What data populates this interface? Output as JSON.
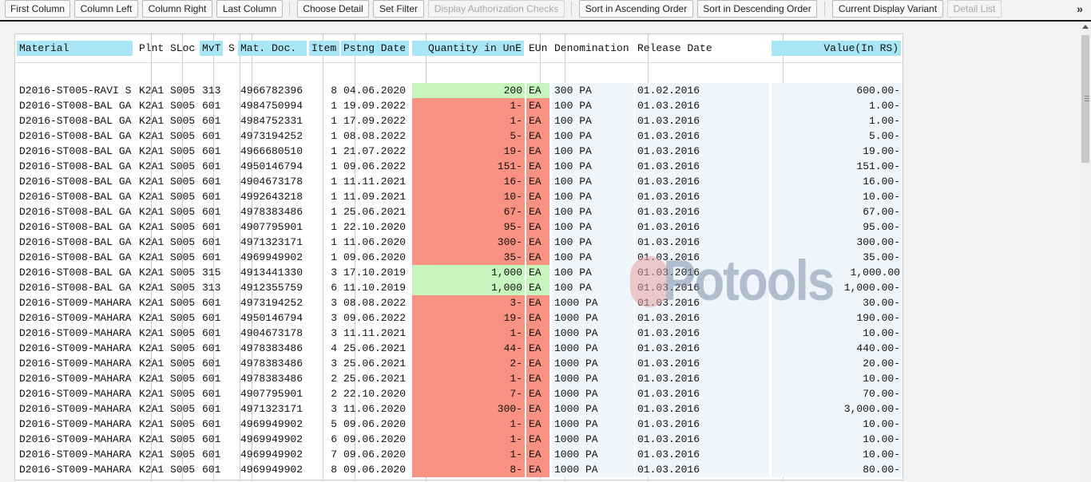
{
  "toolbar": {
    "buttons": [
      {
        "label": "First Column",
        "disabled": false
      },
      {
        "label": "Column Left",
        "disabled": false
      },
      {
        "label": "Column Right",
        "disabled": false
      },
      {
        "label": "Last Column",
        "disabled": false
      },
      {
        "label": "Choose Detail",
        "disabled": false
      },
      {
        "label": "Set Filter",
        "disabled": false
      },
      {
        "label": "Display Authorization Checks",
        "disabled": true
      },
      {
        "label": "Sort in Ascending Order",
        "disabled": false
      },
      {
        "label": "Sort in Descending Order",
        "disabled": false
      },
      {
        "label": "Current Display Variant",
        "disabled": false
      },
      {
        "label": "Detail List",
        "disabled": true
      }
    ],
    "more_label": "»"
  },
  "columns": [
    "Material",
    "Plnt",
    "SLoc",
    "MvT",
    "S",
    "Mat. Doc.",
    "Item",
    "Pstng Date",
    "Quantity in UnE",
    "EUn",
    "Denomination",
    "Release Date",
    "Value(In RS)"
  ],
  "watermark_text": "Potools",
  "colors": {
    "header_bg": "#a9e6f5",
    "negative_qty": "#fa9283",
    "positive_qty": "#c6f5bd",
    "light_cell": "#eef6fc"
  },
  "rows": [
    {
      "material": "D2016-ST005-RAVI S",
      "plnt": "K2A1",
      "sloc": "S005",
      "mvt": "313",
      "s": "",
      "matdoc": "4966782396",
      "item": "8",
      "date": "04.06.2020",
      "qty": "200",
      "eun": "EA",
      "denom": "300 PA",
      "release": "01.02.2016",
      "value": "600.00-",
      "sign": "pos"
    },
    {
      "material": "D2016-ST008-BAL GA",
      "plnt": "K2A1",
      "sloc": "S005",
      "mvt": "601",
      "s": "",
      "matdoc": "4984750994",
      "item": "1",
      "date": "19.09.2022",
      "qty": "1-",
      "eun": "EA",
      "denom": "100 PA",
      "release": "01.03.2016",
      "value": "1.00-",
      "sign": "neg"
    },
    {
      "material": "D2016-ST008-BAL GA",
      "plnt": "K2A1",
      "sloc": "S005",
      "mvt": "601",
      "s": "",
      "matdoc": "4984752331",
      "item": "1",
      "date": "17.09.2022",
      "qty": "1-",
      "eun": "EA",
      "denom": "100 PA",
      "release": "01.03.2016",
      "value": "1.00-",
      "sign": "neg"
    },
    {
      "material": "D2016-ST008-BAL GA",
      "plnt": "K2A1",
      "sloc": "S005",
      "mvt": "601",
      "s": "",
      "matdoc": "4973194252",
      "item": "1",
      "date": "08.08.2022",
      "qty": "5-",
      "eun": "EA",
      "denom": "100 PA",
      "release": "01.03.2016",
      "value": "5.00-",
      "sign": "neg"
    },
    {
      "material": "D2016-ST008-BAL GA",
      "plnt": "K2A1",
      "sloc": "S005",
      "mvt": "601",
      "s": "",
      "matdoc": "4966680510",
      "item": "1",
      "date": "21.07.2022",
      "qty": "19-",
      "eun": "EA",
      "denom": "100 PA",
      "release": "01.03.2016",
      "value": "19.00-",
      "sign": "neg"
    },
    {
      "material": "D2016-ST008-BAL GA",
      "plnt": "K2A1",
      "sloc": "S005",
      "mvt": "601",
      "s": "",
      "matdoc": "4950146794",
      "item": "1",
      "date": "09.06.2022",
      "qty": "151-",
      "eun": "EA",
      "denom": "100 PA",
      "release": "01.03.2016",
      "value": "151.00-",
      "sign": "neg"
    },
    {
      "material": "D2016-ST008-BAL GA",
      "plnt": "K2A1",
      "sloc": "S005",
      "mvt": "601",
      "s": "",
      "matdoc": "4904673178",
      "item": "1",
      "date": "11.11.2021",
      "qty": "16-",
      "eun": "EA",
      "denom": "100 PA",
      "release": "01.03.2016",
      "value": "16.00-",
      "sign": "neg"
    },
    {
      "material": "D2016-ST008-BAL GA",
      "plnt": "K2A1",
      "sloc": "S005",
      "mvt": "601",
      "s": "",
      "matdoc": "4992643218",
      "item": "1",
      "date": "11.09.2021",
      "qty": "10-",
      "eun": "EA",
      "denom": "100 PA",
      "release": "01.03.2016",
      "value": "10.00-",
      "sign": "neg"
    },
    {
      "material": "D2016-ST008-BAL GA",
      "plnt": "K2A1",
      "sloc": "S005",
      "mvt": "601",
      "s": "",
      "matdoc": "4978383486",
      "item": "1",
      "date": "25.06.2021",
      "qty": "67-",
      "eun": "EA",
      "denom": "100 PA",
      "release": "01.03.2016",
      "value": "67.00-",
      "sign": "neg"
    },
    {
      "material": "D2016-ST008-BAL GA",
      "plnt": "K2A1",
      "sloc": "S005",
      "mvt": "601",
      "s": "",
      "matdoc": "4907795901",
      "item": "1",
      "date": "22.10.2020",
      "qty": "95-",
      "eun": "EA",
      "denom": "100 PA",
      "release": "01.03.2016",
      "value": "95.00-",
      "sign": "neg"
    },
    {
      "material": "D2016-ST008-BAL GA",
      "plnt": "K2A1",
      "sloc": "S005",
      "mvt": "601",
      "s": "",
      "matdoc": "4971323171",
      "item": "1",
      "date": "11.06.2020",
      "qty": "300-",
      "eun": "EA",
      "denom": "100 PA",
      "release": "01.03.2016",
      "value": "300.00-",
      "sign": "neg"
    },
    {
      "material": "D2016-ST008-BAL GA",
      "plnt": "K2A1",
      "sloc": "S005",
      "mvt": "601",
      "s": "",
      "matdoc": "4969949902",
      "item": "1",
      "date": "09.06.2020",
      "qty": "35-",
      "eun": "EA",
      "denom": "100 PA",
      "release": "01.03.2016",
      "value": "35.00-",
      "sign": "neg"
    },
    {
      "material": "D2016-ST008-BAL GA",
      "plnt": "K2A1",
      "sloc": "S005",
      "mvt": "315",
      "s": "",
      "matdoc": "4913441330",
      "item": "3",
      "date": "17.10.2019",
      "qty": "1,000",
      "eun": "EA",
      "denom": "100 PA",
      "release": "01.03.2016",
      "value": "1,000.00",
      "sign": "pos"
    },
    {
      "material": "D2016-ST008-BAL GA",
      "plnt": "K2A1",
      "sloc": "S005",
      "mvt": "313",
      "s": "",
      "matdoc": "4912355759",
      "item": "6",
      "date": "11.10.2019",
      "qty": "1,000",
      "eun": "EA",
      "denom": "100 PA",
      "release": "01.03.2016",
      "value": "1,000.00-",
      "sign": "pos"
    },
    {
      "material": "D2016-ST009-MAHARA",
      "plnt": "K2A1",
      "sloc": "S005",
      "mvt": "601",
      "s": "",
      "matdoc": "4973194252",
      "item": "3",
      "date": "08.08.2022",
      "qty": "3-",
      "eun": "EA",
      "denom": "1000 PA",
      "release": "01.03.2016",
      "value": "30.00-",
      "sign": "neg"
    },
    {
      "material": "D2016-ST009-MAHARA",
      "plnt": "K2A1",
      "sloc": "S005",
      "mvt": "601",
      "s": "",
      "matdoc": "4950146794",
      "item": "3",
      "date": "09.06.2022",
      "qty": "19-",
      "eun": "EA",
      "denom": "1000 PA",
      "release": "01.03.2016",
      "value": "190.00-",
      "sign": "neg"
    },
    {
      "material": "D2016-ST009-MAHARA",
      "plnt": "K2A1",
      "sloc": "S005",
      "mvt": "601",
      "s": "",
      "matdoc": "4904673178",
      "item": "3",
      "date": "11.11.2021",
      "qty": "1-",
      "eun": "EA",
      "denom": "1000 PA",
      "release": "01.03.2016",
      "value": "10.00-",
      "sign": "neg"
    },
    {
      "material": "D2016-ST009-MAHARA",
      "plnt": "K2A1",
      "sloc": "S005",
      "mvt": "601",
      "s": "",
      "matdoc": "4978383486",
      "item": "4",
      "date": "25.06.2021",
      "qty": "44-",
      "eun": "EA",
      "denom": "1000 PA",
      "release": "01.03.2016",
      "value": "440.00-",
      "sign": "neg"
    },
    {
      "material": "D2016-ST009-MAHARA",
      "plnt": "K2A1",
      "sloc": "S005",
      "mvt": "601",
      "s": "",
      "matdoc": "4978383486",
      "item": "3",
      "date": "25.06.2021",
      "qty": "2-",
      "eun": "EA",
      "denom": "1000 PA",
      "release": "01.03.2016",
      "value": "20.00-",
      "sign": "neg"
    },
    {
      "material": "D2016-ST009-MAHARA",
      "plnt": "K2A1",
      "sloc": "S005",
      "mvt": "601",
      "s": "",
      "matdoc": "4978383486",
      "item": "2",
      "date": "25.06.2021",
      "qty": "1-",
      "eun": "EA",
      "denom": "1000 PA",
      "release": "01.03.2016",
      "value": "10.00-",
      "sign": "neg"
    },
    {
      "material": "D2016-ST009-MAHARA",
      "plnt": "K2A1",
      "sloc": "S005",
      "mvt": "601",
      "s": "",
      "matdoc": "4907795901",
      "item": "2",
      "date": "22.10.2020",
      "qty": "7-",
      "eun": "EA",
      "denom": "1000 PA",
      "release": "01.03.2016",
      "value": "70.00-",
      "sign": "neg"
    },
    {
      "material": "D2016-ST009-MAHARA",
      "plnt": "K2A1",
      "sloc": "S005",
      "mvt": "601",
      "s": "",
      "matdoc": "4971323171",
      "item": "3",
      "date": "11.06.2020",
      "qty": "300-",
      "eun": "EA",
      "denom": "1000 PA",
      "release": "01.03.2016",
      "value": "3,000.00-",
      "sign": "neg"
    },
    {
      "material": "D2016-ST009-MAHARA",
      "plnt": "K2A1",
      "sloc": "S005",
      "mvt": "601",
      "s": "",
      "matdoc": "4969949902",
      "item": "5",
      "date": "09.06.2020",
      "qty": "1-",
      "eun": "EA",
      "denom": "1000 PA",
      "release": "01.03.2016",
      "value": "10.00-",
      "sign": "neg"
    },
    {
      "material": "D2016-ST009-MAHARA",
      "plnt": "K2A1",
      "sloc": "S005",
      "mvt": "601",
      "s": "",
      "matdoc": "4969949902",
      "item": "6",
      "date": "09.06.2020",
      "qty": "1-",
      "eun": "EA",
      "denom": "1000 PA",
      "release": "01.03.2016",
      "value": "10.00-",
      "sign": "neg"
    },
    {
      "material": "D2016-ST009-MAHARA",
      "plnt": "K2A1",
      "sloc": "S005",
      "mvt": "601",
      "s": "",
      "matdoc": "4969949902",
      "item": "7",
      "date": "09.06.2020",
      "qty": "1-",
      "eun": "EA",
      "denom": "1000 PA",
      "release": "01.03.2016",
      "value": "10.00-",
      "sign": "neg"
    },
    {
      "material": "D2016-ST009-MAHARA",
      "plnt": "K2A1",
      "sloc": "S005",
      "mvt": "601",
      "s": "",
      "matdoc": "4969949902",
      "item": "8",
      "date": "09.06.2020",
      "qty": "8-",
      "eun": "EA",
      "denom": "1000 PA",
      "release": "01.03.2016",
      "value": "80.00-",
      "sign": "neg"
    }
  ]
}
